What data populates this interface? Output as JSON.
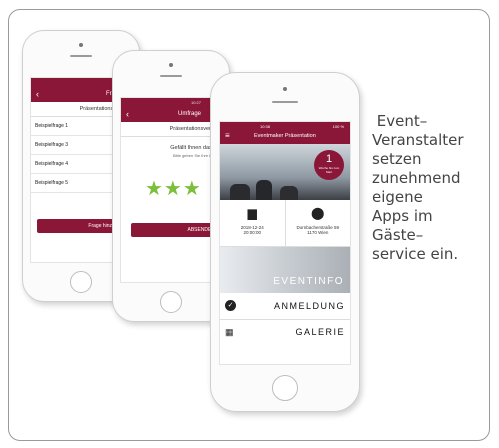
{
  "phone1": {
    "title": "Fragen",
    "subheading": "Präsentationsveran",
    "items": [
      "Beispielfrage 1",
      "Beispielfrage 3",
      "Beispielfrage 4",
      "Beispielfrage 5"
    ],
    "button": "Frage hinzufü"
  },
  "phone2": {
    "time": "10:27",
    "title": "Umfrage",
    "subheading": "Präsentationsveran",
    "question": "Gefällt Ihnen das V",
    "hint": "Bitte geben Sie Ihre Bew",
    "stars": "★★★",
    "button": "ABSENDEN"
  },
  "phone3": {
    "status": "10:38",
    "battery": "100 %",
    "title": "Eventmaker Präsentation",
    "badge_number": "1",
    "badge_text": "Woche bis zum Start",
    "date": "2018-12-24",
    "time": "20:00:00",
    "address1": "Dornbacherstraße 59",
    "address2": "1170 Wien",
    "eventinfo": "EVENTINFO",
    "menu_anmeldung": "ANMELDUNG",
    "menu_galerie": "GALERIE"
  },
  "caption": " Event–\nVeranstalter\nsetzen\nzunehmend\neigene\nApps im\nGäste–\nservice ein."
}
